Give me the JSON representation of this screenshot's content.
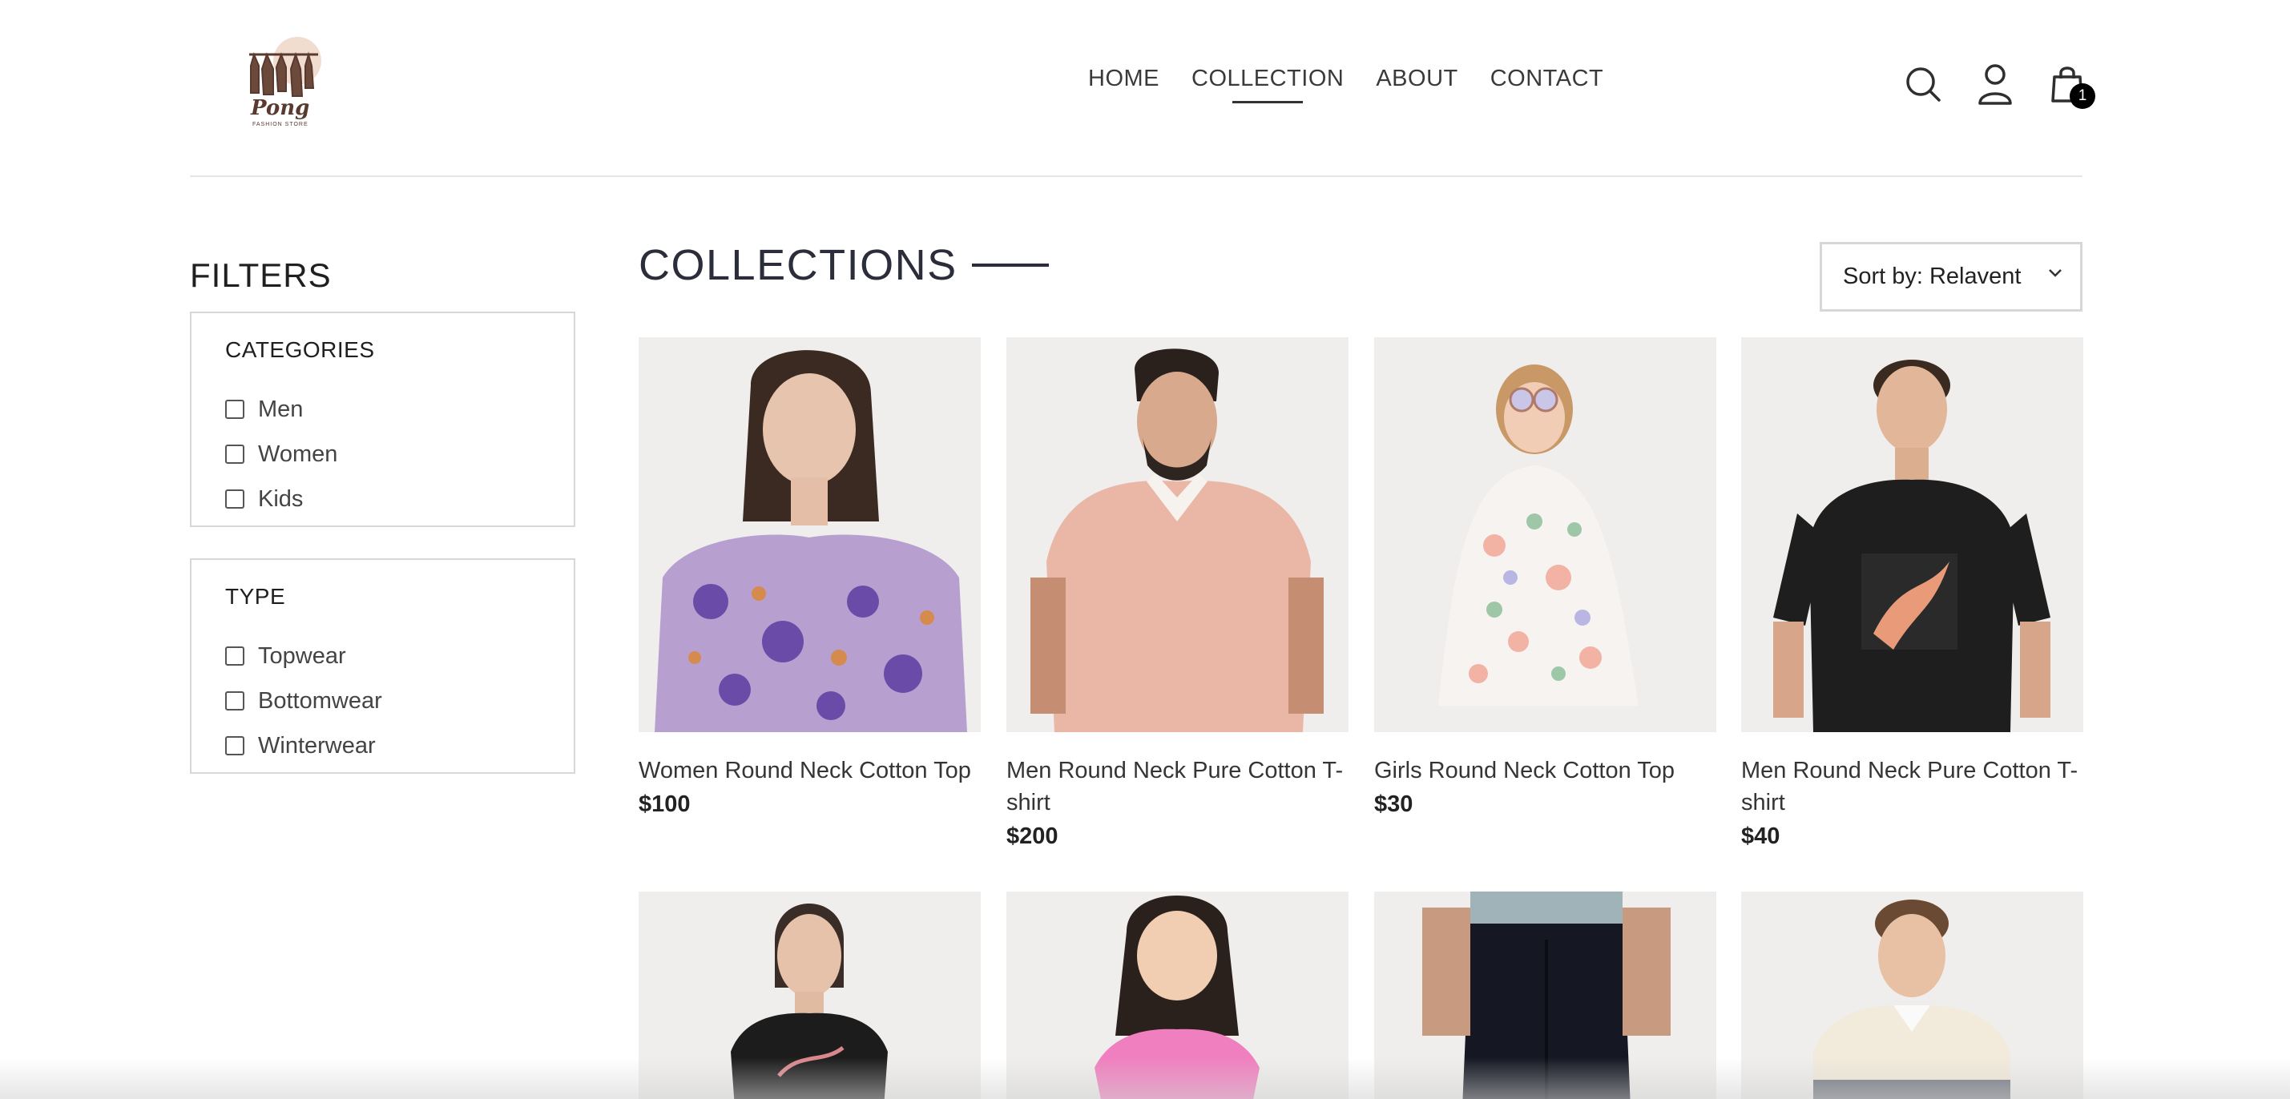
{
  "header": {
    "logo_text": "Pong",
    "logo_subtext": "FASHION STORE",
    "nav": [
      {
        "label": "HOME"
      },
      {
        "label": "COLLECTION",
        "active": true
      },
      {
        "label": "ABOUT"
      },
      {
        "label": "CONTACT"
      }
    ],
    "icons": [
      "search-icon",
      "user-icon",
      "shopping-bag-icon"
    ],
    "cart_count": "1"
  },
  "filters": {
    "title": "FILTERS",
    "categories": {
      "heading": "CATEGORIES",
      "options": [
        "Men",
        "Women",
        "Kids"
      ]
    },
    "type": {
      "heading": "TYPE",
      "options": [
        "Topwear",
        "Bottomwear",
        "Winterwear"
      ]
    }
  },
  "collections": {
    "title": "COLLECTIONS",
    "sort_label": "Sort by: Relavent"
  },
  "products": [
    {
      "name": "Women Round Neck Cotton Top",
      "price": "$100"
    },
    {
      "name": "Men Round Neck Pure Cotton T-shirt",
      "price": "$200"
    },
    {
      "name": "Girls Round Neck Cotton Top",
      "price": "$30"
    },
    {
      "name": "Men Round Neck Pure Cotton T-shirt",
      "price": "$40"
    }
  ],
  "colors": {
    "accent": "#2b2e3a",
    "badge": "#000000",
    "image_bg": "#f0efee"
  }
}
